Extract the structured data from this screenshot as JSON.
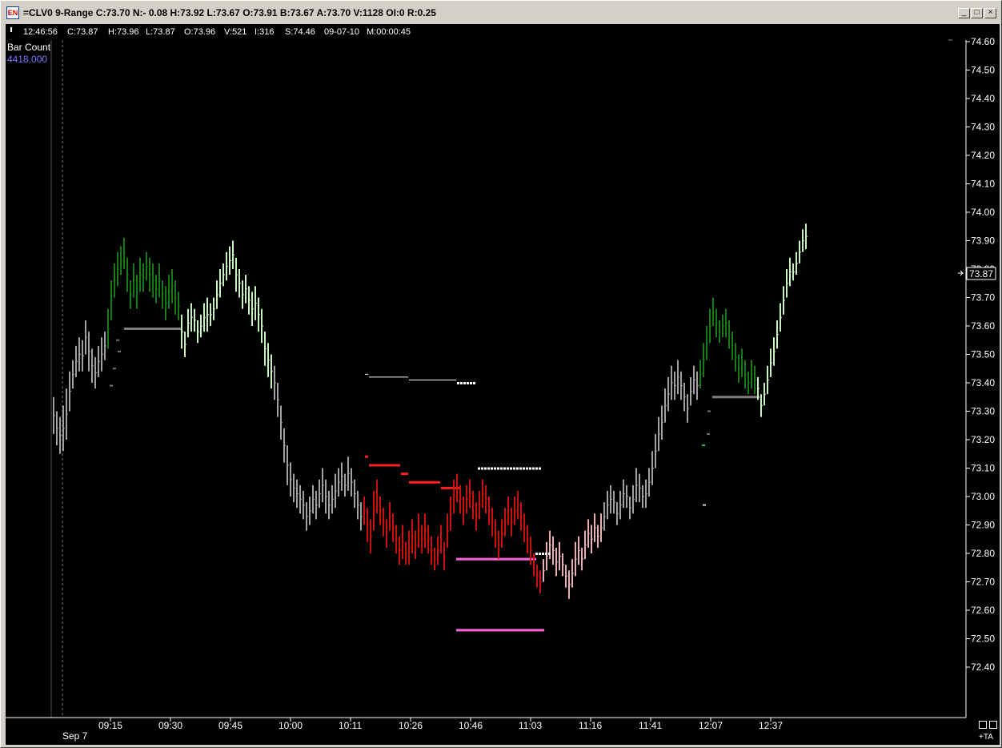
{
  "window": {
    "icon_label": "EN",
    "title": "=CLV0 9-Range C:73.70 N:- 0.08 H:73.92 L:73.67 O:73.91 B:73.67 A:73.70 V:1128 OI:0 R:0.25",
    "min_label": "_",
    "max_label": "□",
    "close_label": "×"
  },
  "infobar": {
    "items": [
      "12:46:56",
      "C:73.87",
      "H:73.96",
      "L:73.87",
      "O:73.96",
      "V:521",
      "I:316",
      "S:74.46",
      "09-07-10",
      "M:00:00:45"
    ]
  },
  "indicator": {
    "name": "Bar Count",
    "value": "4418.000"
  },
  "price_axis": {
    "ticks": [
      "74.60",
      "74.50",
      "74.40",
      "74.30",
      "74.20",
      "74.10",
      "74.00",
      "73.90",
      "73.80",
      "73.70",
      "73.60",
      "73.50",
      "73.40",
      "73.30",
      "73.20",
      "73.10",
      "73.00",
      "72.90",
      "72.80",
      "72.70",
      "72.60",
      "72.50",
      "72.40"
    ],
    "last_price": "73.87"
  },
  "time_axis": {
    "date_label": "Sep 7",
    "ticks": [
      "09:15",
      "09:30",
      "09:45",
      "10:00",
      "10:11",
      "10:26",
      "10:46",
      "11:03",
      "11:16",
      "11:41",
      "12:07",
      "12:37"
    ]
  },
  "corner": {
    "ta_label": "+TA"
  },
  "colors": {
    "background": "#000000",
    "up_strong": "#1a7a1a",
    "up_light": "#c8f0c0",
    "neutral": "#a0a0a0",
    "down_strong": "#cc1111",
    "down_light": "#e8b0b0",
    "magenta": "#ff66dd",
    "indicator_value": "#7777ff"
  }
}
